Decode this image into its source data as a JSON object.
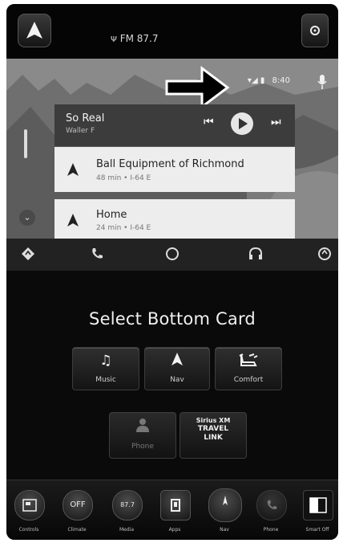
{
  "topbar": {
    "radio_status": "FM 87.7"
  },
  "android_auto": {
    "status_time": "8:40",
    "music": {
      "title": "So Real",
      "artist": "Waller F"
    },
    "nav_cards": [
      {
        "title": "Ball Equipment of Richmond",
        "subtitle": "48 min • I-64 E"
      },
      {
        "title": "Home",
        "subtitle": "24 min • I-64 E"
      }
    ]
  },
  "selector": {
    "heading": "Select Bottom Card",
    "options": [
      {
        "label": "Music",
        "icon": "music-note-icon"
      },
      {
        "label": "Nav",
        "icon": "nav-arrow-icon"
      },
      {
        "label": "Comfort",
        "icon": "seat-icon"
      },
      {
        "label": "Phone",
        "icon": "person-icon"
      },
      {
        "label": "Sirius XM TRAVEL LINK",
        "line1": "Sirius XM",
        "line2": "TRAVEL",
        "line3": "LINK"
      }
    ]
  },
  "bottom_bar": [
    {
      "label": "Controls",
      "text": ""
    },
    {
      "label": "Climate",
      "text": "OFF"
    },
    {
      "label": "Media",
      "text": "87.7"
    },
    {
      "label": "Apps",
      "text": ""
    },
    {
      "label": "Nav",
      "text": ""
    },
    {
      "label": "Phone",
      "text": ""
    },
    {
      "label": "Smart Off",
      "text": ""
    }
  ]
}
